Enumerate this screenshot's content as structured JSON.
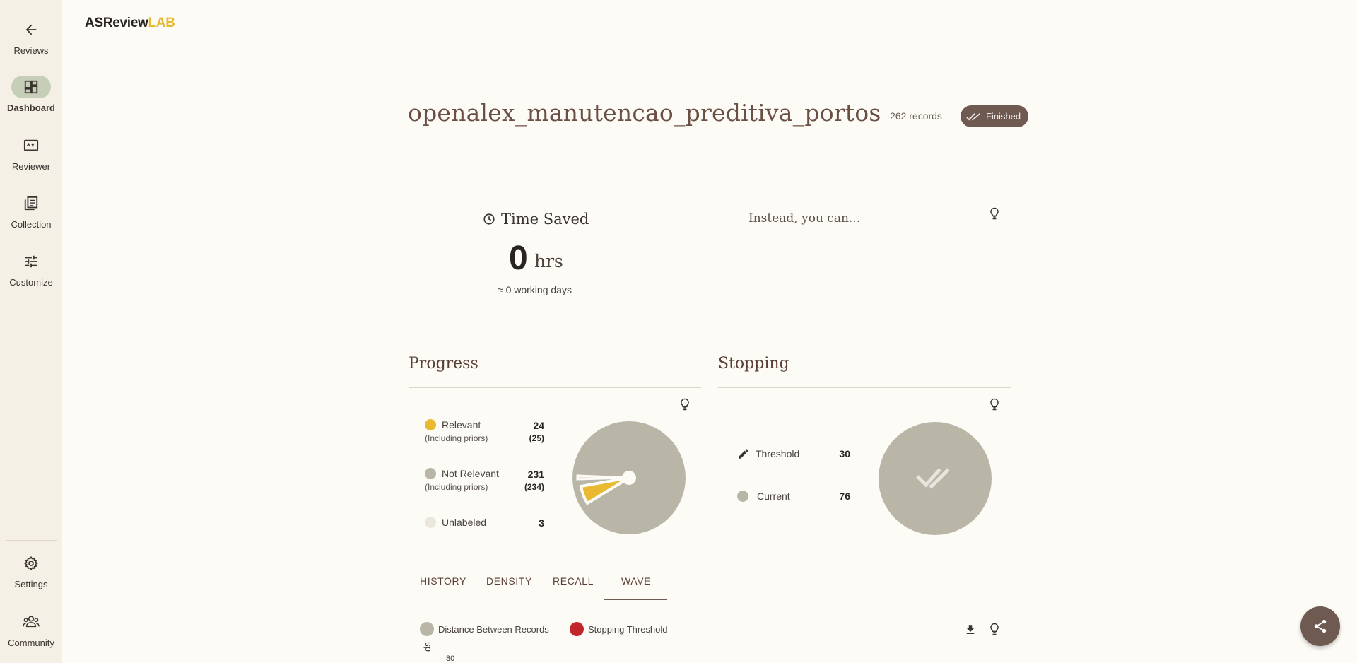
{
  "app": {
    "logo_main": "ASReview",
    "logo_accent": "LAB"
  },
  "sidebar": {
    "items": [
      {
        "label": "Reviews",
        "icon": "arrow-back-icon"
      },
      {
        "label": "Dashboard",
        "icon": "dashboard-icon",
        "active": true
      },
      {
        "label": "Reviewer",
        "icon": "reviewer-icon"
      },
      {
        "label": "Collection",
        "icon": "collection-icon"
      },
      {
        "label": "Customize",
        "icon": "tune-icon"
      }
    ],
    "bottom": [
      {
        "label": "Settings",
        "icon": "gear-icon"
      },
      {
        "label": "Community",
        "icon": "community-icon"
      }
    ]
  },
  "project": {
    "title": "openalex_manutencao_preditiva_portos",
    "records": "262 records",
    "status": "Finished"
  },
  "time_saved": {
    "title": "Time Saved",
    "value": "0",
    "unit": "hrs",
    "days": "≈ 0 working days",
    "instead": "Instead, you can..."
  },
  "progress": {
    "title": "Progress",
    "relevant_label": "Relevant",
    "relevant_sub": "(Including priors)",
    "relevant_value": "24",
    "relevant_total": "(25)",
    "not_relevant_label": "Not Relevant",
    "not_relevant_sub": "(Including priors)",
    "not_relevant_value": "231",
    "not_relevant_total": "(234)",
    "unlabeled_label": "Unlabeled",
    "unlabeled_value": "3"
  },
  "stopping": {
    "title": "Stopping",
    "threshold_label": "Threshold",
    "threshold_value": "30",
    "current_label": "Current",
    "current_value": "76"
  },
  "tabs": [
    "HISTORY",
    "DENSITY",
    "RECALL",
    "WAVE"
  ],
  "active_tab": "WAVE",
  "chart_legend": {
    "distance": "Distance Between Records",
    "stopping": "Stopping Threshold",
    "ylabel_fragment": "ds",
    "ytick_fragment": "80"
  },
  "colors": {
    "relevant": "#e8b931",
    "not_relevant": "#b9b6a8",
    "unlabeled": "#ebe7dc",
    "stopping_threshold": "#c0262c",
    "accent": "#6e5a50"
  }
}
